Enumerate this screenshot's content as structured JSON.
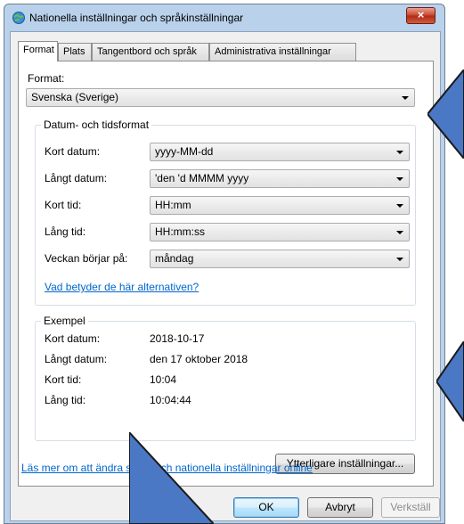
{
  "window": {
    "title": "Nationella inställningar och språkinställningar",
    "close_label": "×"
  },
  "tabs": [
    {
      "label": "Format"
    },
    {
      "label": "Plats"
    },
    {
      "label": "Tangentbord och språk"
    },
    {
      "label": "Administrativa inställningar"
    }
  ],
  "format": {
    "label": "Format:",
    "value": "Svenska (Sverige)"
  },
  "datetime_group": {
    "title": "Datum- och tidsformat",
    "rows": [
      {
        "label": "Kort datum:",
        "value": "yyyy-MM-dd"
      },
      {
        "label": "Långt datum:",
        "value": "'den 'd MMMM yyyy"
      },
      {
        "label": "Kort tid:",
        "value": "HH:mm"
      },
      {
        "label": "Lång tid:",
        "value": "HH:mm:ss"
      },
      {
        "label": "Veckan börjar på:",
        "value": "måndag"
      }
    ],
    "help_link": "Vad betyder de här alternativen?"
  },
  "example_group": {
    "title": "Exempel",
    "rows": [
      {
        "label": "Kort datum:",
        "value": "2018-10-17"
      },
      {
        "label": "Långt datum:",
        "value": "den 17 oktober 2018"
      },
      {
        "label": "Kort tid:",
        "value": "10:04"
      },
      {
        "label": "Lång tid:",
        "value": "10:04:44"
      }
    ]
  },
  "more_settings_button": "Ytterligare inställningar...",
  "online_link": "Läs mer om att ändra språk och nationella inställningar online",
  "buttons": {
    "ok": "OK",
    "cancel": "Avbryt",
    "apply": "Verkställ"
  },
  "colors": {
    "annotation_arrow": "#4a78c4",
    "link": "#0066cc"
  }
}
